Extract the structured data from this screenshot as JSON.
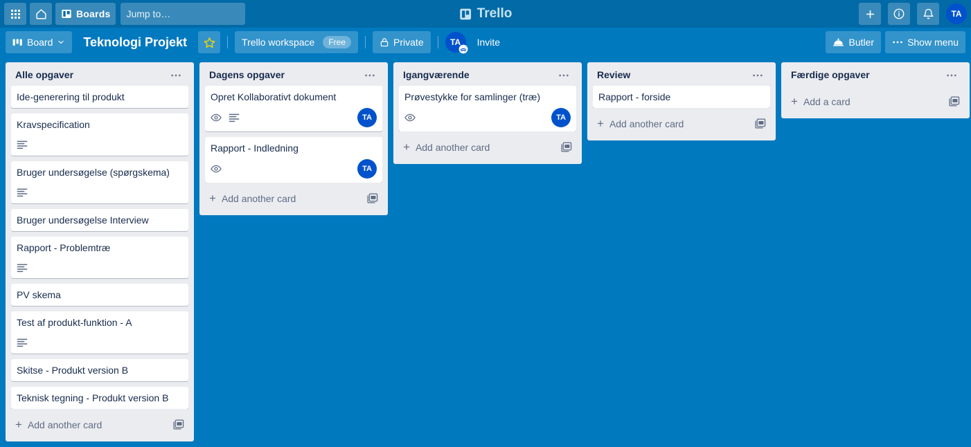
{
  "topnav": {
    "apps_icon": "grid-apps-icon",
    "home_icon": "home-icon",
    "boards_icon": "board-icon",
    "boards_label": "Boards",
    "search_placeholder": "Jump to…",
    "search_value": "",
    "search_icon": "search-icon",
    "brand": "Trello",
    "brand_icon": "trello-logo-icon",
    "add_icon": "plus-icon",
    "info_icon": "info-circle-icon",
    "notifications_icon": "bell-icon",
    "avatar_initials": "TA"
  },
  "boardbar": {
    "view_icon": "board-view-icon",
    "view_label": "Board",
    "view_chevron": "chevron-down-icon",
    "title": "Teknologi Projekt",
    "star_icon": "star-icon",
    "star_color": "#f2d600",
    "workspace_label": "Trello workspace",
    "plan_badge": "Free",
    "visibility_icon": "lock-icon",
    "visibility_label": "Private",
    "member_initials": "TA",
    "invite_label": "Invite",
    "butler_icon": "butler-bell-icon",
    "butler_label": "Butler",
    "menu_icon": "ellipsis-icon",
    "menu_label": "Show menu"
  },
  "colors": {
    "nav_bg": "#026aa7",
    "board_bg": "#0079bf",
    "list_bg": "#ebecf0",
    "card_bg": "#ffffff",
    "text": "#172b4d",
    "muted": "#5e6c84",
    "avatar_bg": "#0052cc"
  },
  "lists": [
    {
      "title": "Alle opgaver",
      "menu_icon": "ellipsis-icon",
      "add_label": "Add another card",
      "add_icon": "plus-icon",
      "template_icon": "card-template-icon",
      "cards": [
        {
          "title": "Ide-generering til produkt",
          "watching": false,
          "description": false,
          "avatar": ""
        },
        {
          "title": "Kravspecification",
          "watching": false,
          "description": true,
          "avatar": ""
        },
        {
          "title": "Bruger undersøgelse (spørgskema)",
          "watching": false,
          "description": true,
          "avatar": ""
        },
        {
          "title": "Bruger undersøgelse Interview",
          "watching": false,
          "description": false,
          "avatar": ""
        },
        {
          "title": "Rapport - Problemtræ",
          "watching": false,
          "description": true,
          "avatar": ""
        },
        {
          "title": "PV skema",
          "watching": false,
          "description": false,
          "avatar": ""
        },
        {
          "title": "Test af produkt-funktion - A",
          "watching": false,
          "description": true,
          "avatar": ""
        },
        {
          "title": "Skitse - Produkt version B",
          "watching": false,
          "description": false,
          "avatar": ""
        },
        {
          "title": "Teknisk tegning - Produkt version B",
          "watching": false,
          "description": false,
          "avatar": ""
        }
      ]
    },
    {
      "title": "Dagens opgaver",
      "menu_icon": "ellipsis-icon",
      "add_label": "Add another card",
      "add_icon": "plus-icon",
      "template_icon": "card-template-icon",
      "cards": [
        {
          "title": "Opret Kollaborativt dokument",
          "watching": true,
          "description": true,
          "avatar": "TA"
        },
        {
          "title": "Rapport - Indledning",
          "watching": true,
          "description": false,
          "avatar": "TA"
        }
      ]
    },
    {
      "title": "Igangværende",
      "menu_icon": "ellipsis-icon",
      "add_label": "Add another card",
      "add_icon": "plus-icon",
      "template_icon": "card-template-icon",
      "cards": [
        {
          "title": "Prøvestykke for samlinger (træ)",
          "watching": true,
          "description": false,
          "avatar": "TA"
        }
      ]
    },
    {
      "title": "Review",
      "menu_icon": "ellipsis-icon",
      "add_label": "Add another card",
      "add_icon": "plus-icon",
      "template_icon": "card-template-icon",
      "cards": [
        {
          "title": "Rapport - forside",
          "watching": false,
          "description": false,
          "avatar": ""
        }
      ]
    },
    {
      "title": "Færdige opgaver",
      "menu_icon": "ellipsis-icon",
      "add_label": "Add a card",
      "add_icon": "plus-icon",
      "template_icon": "card-template-icon",
      "cards": []
    }
  ]
}
